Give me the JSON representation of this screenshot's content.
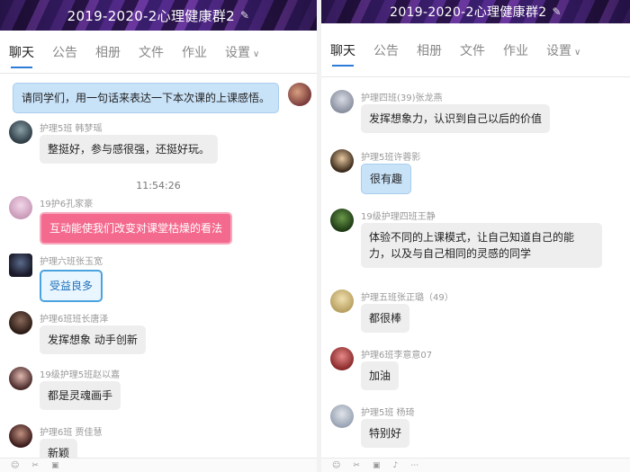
{
  "left": {
    "title": "2019-2020-2心理健康群2",
    "tabs": [
      {
        "label": "聊天",
        "active": true
      },
      {
        "label": "公告"
      },
      {
        "label": "相册"
      },
      {
        "label": "文件"
      },
      {
        "label": "作业"
      },
      {
        "label": "设置"
      }
    ],
    "self_message": "请同学们，用一句话来表达一下本次课的上课感悟。",
    "timestamp": "11:54:26",
    "messages": [
      {
        "sender": "护理5班  韩梦瑶",
        "text": "整挺好，参与感很强，还挺好玩。"
      },
      {
        "sender": "19护6孔家豪",
        "text": "互动能使我们改变对课堂枯燥的看法"
      },
      {
        "sender": "护理六班张玉宽",
        "text": "受益良多"
      },
      {
        "sender": "护理6班班长唐泽",
        "text": "发挥想象 动手创新"
      },
      {
        "sender": "19级护理5班赵以嘉",
        "text": "都是灵魂画手"
      },
      {
        "sender": "护理6班   贾佳慧",
        "text": "新颖"
      }
    ]
  },
  "right": {
    "title": "2019-2020-2心理健康群2",
    "tabs": [
      {
        "label": "聊天",
        "active": true
      },
      {
        "label": "公告"
      },
      {
        "label": "相册"
      },
      {
        "label": "文件"
      },
      {
        "label": "作业"
      },
      {
        "label": "设置"
      }
    ],
    "messages": [
      {
        "sender": "护理四班(39)张龙燕",
        "text": "发挥想象力，认识到自己以后的价值"
      },
      {
        "sender": "护理5班许蓉影",
        "text": "很有趣"
      },
      {
        "sender": "19级护理四班王静",
        "text": "体验不同的上课模式，让自己知道自己的能力，以及与自己相同的灵感的同学"
      },
      {
        "sender": "护理五班张正璐（49）",
        "text": "都很棒"
      },
      {
        "sender": "护理6班李意意07",
        "text": "加油"
      },
      {
        "sender": "护理5班   杨琦",
        "text": "特别好"
      }
    ]
  },
  "colors": {
    "accent_tab": "#2d7bd8",
    "bubble_gray": "#eeeeee",
    "bubble_self": "#c8e2f8",
    "bubble_pink": "#f46a8e",
    "bubble_boxed_border": "#4aa3df"
  },
  "icons": [
    "edit-icon",
    "chevron-down-icon",
    "avatar"
  ]
}
